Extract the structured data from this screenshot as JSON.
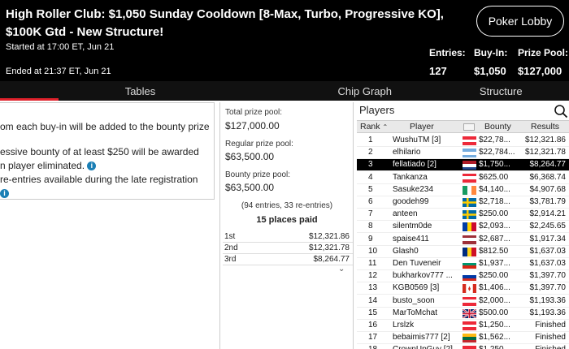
{
  "header": {
    "title": "High Roller Club: $1,050 Sunday Cooldown [8-Max, Turbo, Progressive KO], $100K Gtd - New Structure!",
    "started": "Started at 17:00 ET, Jun 21",
    "ended": "Ended at 21:37 ET, Jun 21",
    "lobby_button": "Poker Lobby",
    "entries_label": "Entries:",
    "entries_value": "127",
    "buyin_label": "Buy-In:",
    "buyin_value": "$1,050",
    "prizepool_label": "Prize Pool:",
    "prizepool_value": "$127,000"
  },
  "tabs": [
    {
      "label": "Tables",
      "active": true
    },
    {
      "label": "Chip Graph",
      "active": false
    },
    {
      "label": "Structure",
      "active": false
    }
  ],
  "info": {
    "line1": "om each buy-in will be added to the bounty prize",
    "line2": "essive bounty of at least $250 will be awarded",
    "line3": "n player eliminated.",
    "line4": "re-entries available during the late registration",
    "icon": "i"
  },
  "prize": {
    "total_label": "Total prize pool:",
    "total_value": "$127,000.00",
    "regular_label": "Regular prize pool:",
    "regular_value": "$63,500.00",
    "bounty_label": "Bounty prize pool:",
    "bounty_value": "$63,500.00",
    "entries_note": "(94 entries, 33 re-entries)",
    "places_paid": "15 places paid",
    "payouts": [
      {
        "place": "1st",
        "amount": "$12,321.86"
      },
      {
        "place": "2nd",
        "amount": "$12,321.78"
      },
      {
        "place": "3rd",
        "amount": "$8,264.77"
      }
    ]
  },
  "players": {
    "title": "Players",
    "headers": {
      "rank": "Rank",
      "player": "Player",
      "bounty": "Bounty",
      "results": "Results"
    },
    "rows": [
      {
        "rank": "1",
        "name": "WushuTM [3]",
        "bounty": "$22,78...",
        "results": "$12,321.86",
        "flag": "at"
      },
      {
        "rank": "2",
        "name": "elhilario",
        "bounty": "$22,784...",
        "results": "$12,321.78",
        "flag": "ar"
      },
      {
        "rank": "3",
        "name": "fellatiado [2]",
        "bounty": "$1,750...",
        "results": "$8,264.77",
        "flag": "nl",
        "selected": true
      },
      {
        "rank": "4",
        "name": "Tankanza",
        "bounty": "$625.00",
        "results": "$6,368.74",
        "flag": "at"
      },
      {
        "rank": "5",
        "name": "Sasuke234",
        "bounty": "$4,140...",
        "results": "$4,907.68",
        "flag": "ie"
      },
      {
        "rank": "6",
        "name": "goodeh99",
        "bounty": "$2,718...",
        "results": "$3,781.79",
        "flag": "se"
      },
      {
        "rank": "7",
        "name": "anteen",
        "bounty": "$250.00",
        "results": "$2,914.21",
        "flag": "se"
      },
      {
        "rank": "8",
        "name": "silentm0de",
        "bounty": "$2,093...",
        "results": "$2,245.65",
        "flag": "md"
      },
      {
        "rank": "9",
        "name": "spaise411",
        "bounty": "$2,687...",
        "results": "$1,917.34",
        "flag": "lv"
      },
      {
        "rank": "10",
        "name": "Glash0",
        "bounty": "$812.50",
        "results": "$1,637.03",
        "flag": "ro"
      },
      {
        "rank": "11",
        "name": "Den Tuveneir",
        "bounty": "$1,937...",
        "results": "$1,637.03",
        "flag": "bg"
      },
      {
        "rank": "12",
        "name": "bukharkov777 ...",
        "bounty": "$250.00",
        "results": "$1,397.70",
        "flag": "ru"
      },
      {
        "rank": "13",
        "name": "KGB0569 [3]",
        "bounty": "$1,406...",
        "results": "$1,397.70",
        "flag": "ca"
      },
      {
        "rank": "14",
        "name": "busto_soon",
        "bounty": "$2,000...",
        "results": "$1,193.36",
        "flag": "at"
      },
      {
        "rank": "15",
        "name": "MarToMchat",
        "bounty": "$500.00",
        "results": "$1,193.36",
        "flag": "gb"
      },
      {
        "rank": "16",
        "name": "Lrslzk",
        "bounty": "$1,250...",
        "results": "Finished",
        "flag": "at"
      },
      {
        "rank": "17",
        "name": "bebaimis777 [2]",
        "bounty": "$1,562...",
        "results": "Finished",
        "flag": "lt"
      },
      {
        "rank": "18",
        "name": "CrownUpGuy [2]",
        "bounty": "$1,250...",
        "results": "Finished",
        "flag": "at"
      }
    ]
  },
  "colors": {
    "header_bg": "#000000",
    "tab_indicator": "#e0212b",
    "selected_row": "#000000",
    "info_icon": "#1a7fb5"
  }
}
